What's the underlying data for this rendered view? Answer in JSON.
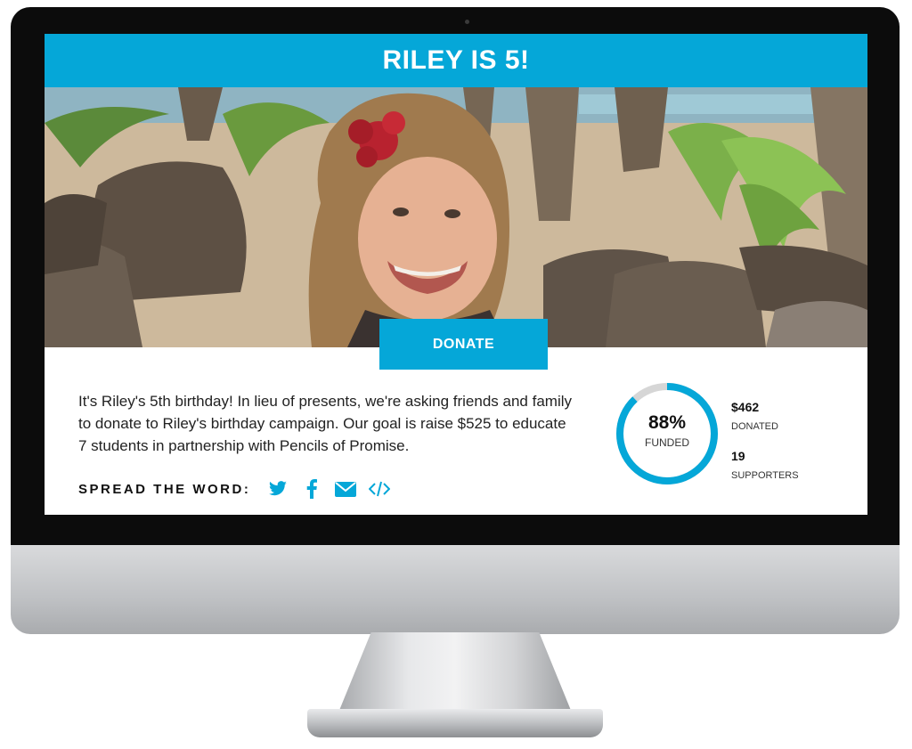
{
  "page": {
    "title": "RILEY IS 5!",
    "donate_label": "DONATE",
    "description": "It's Riley's 5th birthday! In lieu of presents, we're asking friends and family to donate to Riley's birthday campaign. Our goal is raise $525 to educate 7 students in partnership with Pencils of Promise."
  },
  "share": {
    "label": "SPREAD THE WORD:",
    "icons": [
      "twitter-icon",
      "facebook-icon",
      "email-icon",
      "embed-code-icon"
    ]
  },
  "progress": {
    "percent_text": "88%",
    "label": "FUNDED",
    "fraction": 0.88
  },
  "stats": {
    "donated_value": "$462",
    "donated_label": "DONATED",
    "supporters_value": "19",
    "supporters_label": "SUPPORTERS"
  },
  "colors": {
    "accent": "#05a7d8",
    "ring_track": "#d6d6d6"
  }
}
